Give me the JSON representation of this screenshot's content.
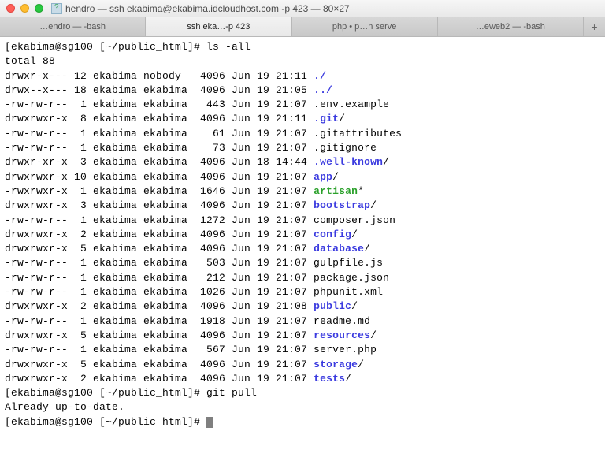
{
  "window": {
    "title": "hendro — ssh ekabima@ekabima.idcloudhost.com -p 423 — 80×27"
  },
  "tabs": [
    {
      "label": "…endro — -bash",
      "active": false
    },
    {
      "label": "ssh eka…-p 423",
      "active": true
    },
    {
      "label": "php • p…n serve",
      "active": false
    },
    {
      "label": "…eweb2 — -bash",
      "active": false
    }
  ],
  "prompt1": {
    "user": "ekabima@sg100",
    "path": "~/public_html",
    "cmd": "ls -all"
  },
  "total_line": "total 88",
  "entries": [
    {
      "perm": "drwxr-x---",
      "links": "12",
      "owner": "ekabima",
      "group": "nobody ",
      "size": " 4096",
      "date": "Jun 19 21:11",
      "name": "./",
      "type": "dir"
    },
    {
      "perm": "drwx--x---",
      "links": "18",
      "owner": "ekabima",
      "group": "ekabima",
      "size": " 4096",
      "date": "Jun 19 21:05",
      "name": "../",
      "type": "dir"
    },
    {
      "perm": "-rw-rw-r--",
      "links": " 1",
      "owner": "ekabima",
      "group": "ekabima",
      "size": "  443",
      "date": "Jun 19 21:07",
      "name": ".env.example",
      "type": "file"
    },
    {
      "perm": "drwxrwxr-x",
      "links": " 8",
      "owner": "ekabima",
      "group": "ekabima",
      "size": " 4096",
      "date": "Jun 19 21:11",
      "name": ".git",
      "type": "dir",
      "suffix": "/"
    },
    {
      "perm": "-rw-rw-r--",
      "links": " 1",
      "owner": "ekabima",
      "group": "ekabima",
      "size": "   61",
      "date": "Jun 19 21:07",
      "name": ".gitattributes",
      "type": "file"
    },
    {
      "perm": "-rw-rw-r--",
      "links": " 1",
      "owner": "ekabima",
      "group": "ekabima",
      "size": "   73",
      "date": "Jun 19 21:07",
      "name": ".gitignore",
      "type": "file"
    },
    {
      "perm": "drwxr-xr-x",
      "links": " 3",
      "owner": "ekabima",
      "group": "ekabima",
      "size": " 4096",
      "date": "Jun 18 14:44",
      "name": ".well-known",
      "type": "dir",
      "suffix": "/"
    },
    {
      "perm": "drwxrwxr-x",
      "links": "10",
      "owner": "ekabima",
      "group": "ekabima",
      "size": " 4096",
      "date": "Jun 19 21:07",
      "name": "app",
      "type": "dir",
      "suffix": "/"
    },
    {
      "perm": "-rwxrwxr-x",
      "links": " 1",
      "owner": "ekabima",
      "group": "ekabima",
      "size": " 1646",
      "date": "Jun 19 21:07",
      "name": "artisan",
      "type": "exe",
      "suffix": "*"
    },
    {
      "perm": "drwxrwxr-x",
      "links": " 3",
      "owner": "ekabima",
      "group": "ekabima",
      "size": " 4096",
      "date": "Jun 19 21:07",
      "name": "bootstrap",
      "type": "dir",
      "suffix": "/"
    },
    {
      "perm": "-rw-rw-r--",
      "links": " 1",
      "owner": "ekabima",
      "group": "ekabima",
      "size": " 1272",
      "date": "Jun 19 21:07",
      "name": "composer.json",
      "type": "file"
    },
    {
      "perm": "drwxrwxr-x",
      "links": " 2",
      "owner": "ekabima",
      "group": "ekabima",
      "size": " 4096",
      "date": "Jun 19 21:07",
      "name": "config",
      "type": "dir",
      "suffix": "/"
    },
    {
      "perm": "drwxrwxr-x",
      "links": " 5",
      "owner": "ekabima",
      "group": "ekabima",
      "size": " 4096",
      "date": "Jun 19 21:07",
      "name": "database",
      "type": "dir",
      "suffix": "/"
    },
    {
      "perm": "-rw-rw-r--",
      "links": " 1",
      "owner": "ekabima",
      "group": "ekabima",
      "size": "  503",
      "date": "Jun 19 21:07",
      "name": "gulpfile.js",
      "type": "file"
    },
    {
      "perm": "-rw-rw-r--",
      "links": " 1",
      "owner": "ekabima",
      "group": "ekabima",
      "size": "  212",
      "date": "Jun 19 21:07",
      "name": "package.json",
      "type": "file"
    },
    {
      "perm": "-rw-rw-r--",
      "links": " 1",
      "owner": "ekabima",
      "group": "ekabima",
      "size": " 1026",
      "date": "Jun 19 21:07",
      "name": "phpunit.xml",
      "type": "file"
    },
    {
      "perm": "drwxrwxr-x",
      "links": " 2",
      "owner": "ekabima",
      "group": "ekabima",
      "size": " 4096",
      "date": "Jun 19 21:08",
      "name": "public",
      "type": "dir",
      "suffix": "/"
    },
    {
      "perm": "-rw-rw-r--",
      "links": " 1",
      "owner": "ekabima",
      "group": "ekabima",
      "size": " 1918",
      "date": "Jun 19 21:07",
      "name": "readme.md",
      "type": "file"
    },
    {
      "perm": "drwxrwxr-x",
      "links": " 5",
      "owner": "ekabima",
      "group": "ekabima",
      "size": " 4096",
      "date": "Jun 19 21:07",
      "name": "resources",
      "type": "dir",
      "suffix": "/"
    },
    {
      "perm": "-rw-rw-r--",
      "links": " 1",
      "owner": "ekabima",
      "group": "ekabima",
      "size": "  567",
      "date": "Jun 19 21:07",
      "name": "server.php",
      "type": "file"
    },
    {
      "perm": "drwxrwxr-x",
      "links": " 5",
      "owner": "ekabima",
      "group": "ekabima",
      "size": " 4096",
      "date": "Jun 19 21:07",
      "name": "storage",
      "type": "dir",
      "suffix": "/"
    },
    {
      "perm": "drwxrwxr-x",
      "links": " 2",
      "owner": "ekabima",
      "group": "ekabima",
      "size": " 4096",
      "date": "Jun 19 21:07",
      "name": "tests",
      "type": "dir",
      "suffix": "/"
    }
  ],
  "prompt2": {
    "user": "ekabima@sg100",
    "path": "~/public_html",
    "cmd": "git pull"
  },
  "gitpull_output": "Already up-to-date.",
  "prompt3": {
    "user": "ekabima@sg100",
    "path": "~/public_html"
  }
}
